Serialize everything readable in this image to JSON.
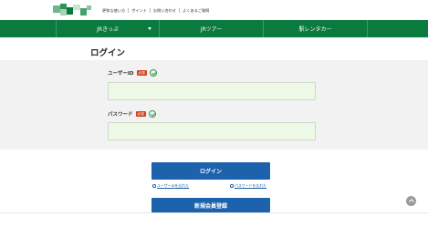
{
  "header": {
    "utility_links": [
      "更和な使い方",
      "ポイント",
      "お問い合わせ",
      "よくあるご質問"
    ]
  },
  "nav": {
    "items": [
      {
        "label": "JRきっぷ",
        "has_dropdown": true
      },
      {
        "label": "JRツアー",
        "has_dropdown": false
      },
      {
        "label": "駅レンタカー",
        "has_dropdown": false
      }
    ]
  },
  "page": {
    "title": "ログイン"
  },
  "form": {
    "user_id": {
      "label": "ユーザーID",
      "required_badge": "必須",
      "value": "",
      "placeholder": ""
    },
    "password": {
      "label": "パスワード",
      "required_badge": "必須",
      "value": "",
      "placeholder": ""
    }
  },
  "actions": {
    "login_label": "ログイン",
    "forgot_id": "ユーザーIDを忘れた",
    "forgot_password": "パスワードを忘れた",
    "register_label": "新規会員登録"
  },
  "colors": {
    "nav_green": "#0b7a3e",
    "primary_blue": "#1d62ad",
    "required_red": "#d2441d",
    "check_green": "#2e9a4c",
    "input_bg": "#eef8e6"
  }
}
